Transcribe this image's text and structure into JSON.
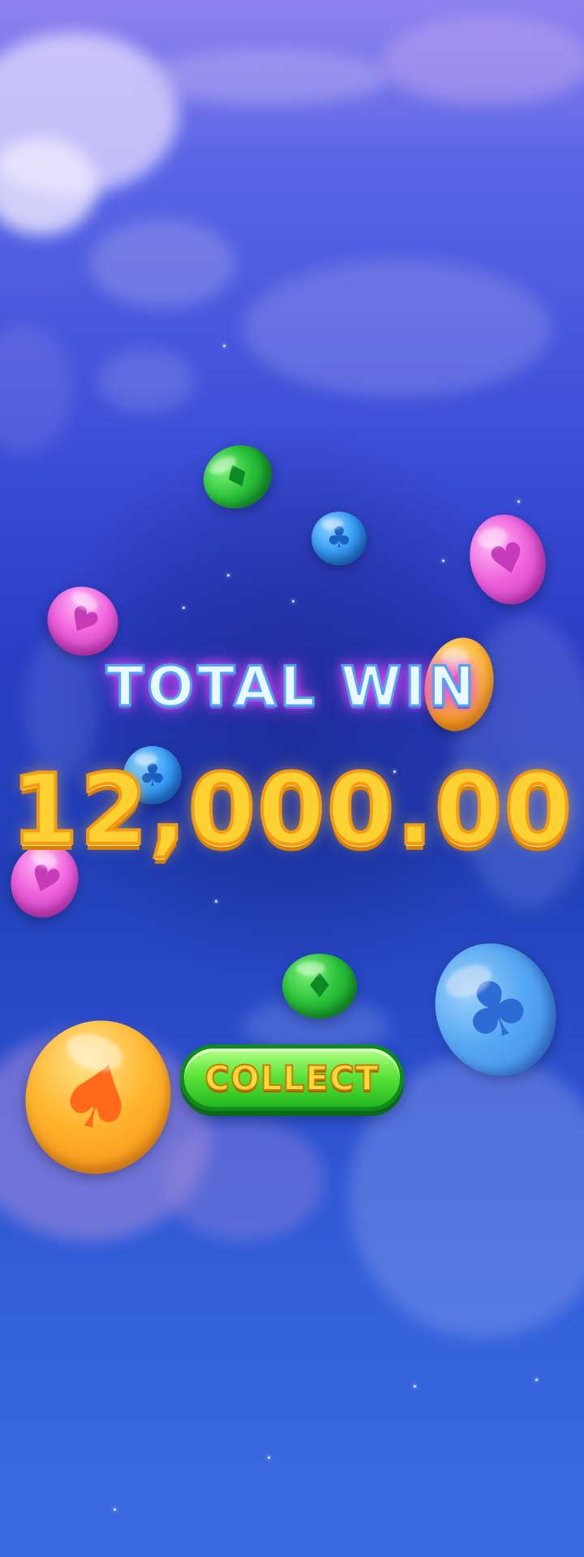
{
  "win_screen": {
    "title": "TOTAL WIN",
    "amount": "12,000.00",
    "collect_label": "COLLECT"
  },
  "gems": [
    {
      "name": "green-diamond-gem",
      "color": "#2bc23a",
      "symbol": "diamond",
      "glyph": "♦"
    },
    {
      "name": "blue-club-gem",
      "color": "#3aa0f5",
      "symbol": "club",
      "glyph": "♣"
    },
    {
      "name": "pink-heart-gem",
      "color": "#ee62dc",
      "symbol": "heart",
      "glyph": "♥"
    },
    {
      "name": "pink-heart-gem-left",
      "color": "#ee62dc",
      "symbol": "heart",
      "glyph": "♥"
    },
    {
      "name": "orange-gem",
      "color": "#ffb52e",
      "symbol": "spade",
      "glyph": "♠"
    },
    {
      "name": "blue-club-gem-left",
      "color": "#3aa0f5",
      "symbol": "club",
      "glyph": "♣"
    },
    {
      "name": "pink-heart-gem-lower-left",
      "color": "#ee62dc",
      "symbol": "heart",
      "glyph": "♥"
    },
    {
      "name": "green-diamond-gem-lower",
      "color": "#2bc23a",
      "symbol": "diamond",
      "glyph": "♦"
    },
    {
      "name": "light-blue-club-gem",
      "color": "#5ab0f7",
      "symbol": "club",
      "glyph": "♣"
    },
    {
      "name": "orange-spade-gem",
      "color": "#ffb52e",
      "symbol": "spade",
      "glyph": "♠"
    }
  ],
  "colors": {
    "title_fill": "#eaf8ff",
    "title_glow": "#ff4df0",
    "amount_fill": "#ffd234",
    "button_green": "#22b81e",
    "button_text": "#ffd93a"
  }
}
